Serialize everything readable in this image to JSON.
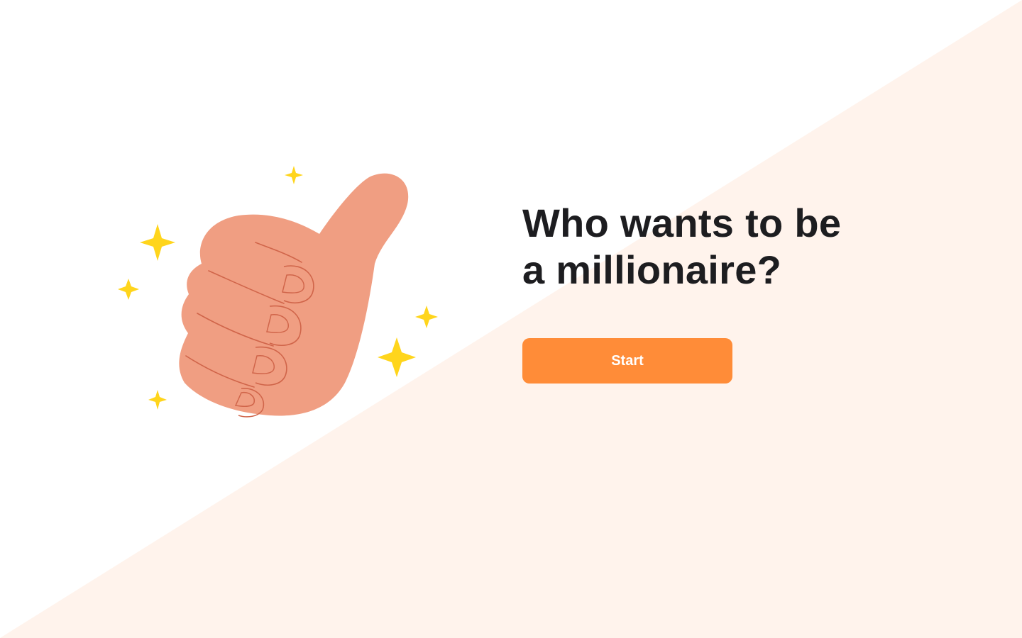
{
  "hero": {
    "title_line1": "Who wants to be",
    "title_line2": "a millionaire?",
    "start_label": "Start"
  },
  "colors": {
    "background": "#ffffff",
    "diagonal_tint": "#fff3ec",
    "accent_button": "#ff8c38",
    "title_text": "#1d1d20",
    "hand_fill": "#f09e82",
    "hand_outline": "#d0654a",
    "sparkle": "#ffd51c"
  },
  "illustration": {
    "icon": "thumbs-up-icon",
    "decorations": "sparkle-icon"
  }
}
